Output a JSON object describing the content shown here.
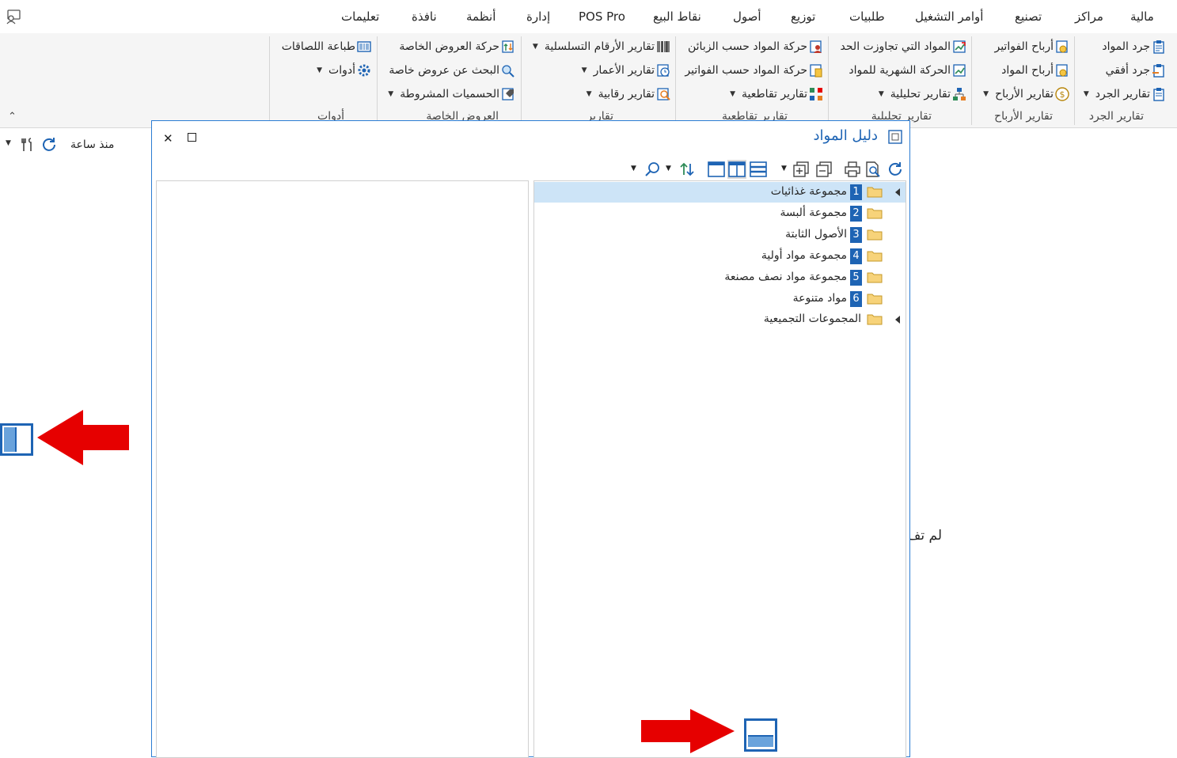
{
  "menu": {
    "items": [
      "مالية",
      "مراكز",
      "تصنيع",
      "أوامر التشغيل",
      "طلبيات",
      "توزيع",
      "أصول",
      "نقاط البيع",
      "POS Pro",
      "إدارة",
      "أنظمة",
      "نافذة",
      "تعليمات"
    ]
  },
  "ribbon": {
    "inventory_reports": {
      "label": "تقارير الجرد",
      "items": [
        "جرد المواد",
        "جرد أفقي",
        "تقارير الجرد"
      ]
    },
    "profit_reports": {
      "label": "تقارير الأرباح",
      "items": [
        "أرباح الفواتير",
        "أرباح المواد",
        "تقارير الأرباح"
      ]
    },
    "analytic_reports": {
      "label": "تقارير تحليلية",
      "items": [
        "المواد التي تجاوزت الحد",
        "الحركة الشهرية للمواد",
        "تقارير تحليلية"
      ]
    },
    "cross_reports": {
      "label": "تقارير تقاطعية",
      "items": [
        "حركة المواد حسب الزبائن",
        "حركة المواد حسب الفواتير",
        "تقارير تقاطعية"
      ]
    },
    "reports": {
      "label": "تقارير",
      "items": [
        "تقارير الأرقام التسلسلية",
        "تقارير الأعمار",
        "تقارير رقابية"
      ]
    },
    "special_offers": {
      "label": "العروض الخاصة",
      "items": [
        "حركة العروض الخاصة",
        "البحث عن عروض خاصة",
        "الحسميات المشروطة"
      ]
    },
    "tools": {
      "label": "أدوات",
      "items": [
        "طباعة اللصاقات",
        "أدوات"
      ]
    }
  },
  "left_pane": {
    "since_label": "منذ ساعة"
  },
  "background_text": "لم تف",
  "dialog": {
    "title": "دليل المواد",
    "tree": [
      {
        "num": "1",
        "label": "مجموعة غذائيات",
        "selected": true,
        "expandable": true
      },
      {
        "num": "2",
        "label": "مجموعة ألبسة",
        "selected": false,
        "expandable": false
      },
      {
        "num": "3",
        "label": "الأصول الثابتة",
        "selected": false,
        "expandable": false
      },
      {
        "num": "4",
        "label": "مجموعة مواد أولية",
        "selected": false,
        "expandable": false
      },
      {
        "num": "5",
        "label": "مجموعة مواد نصف مصنعة",
        "selected": false,
        "expandable": false
      },
      {
        "num": "6",
        "label": "مواد متنوعة",
        "selected": false,
        "expandable": false
      },
      {
        "num": "",
        "label": "المجموعات التجميعية",
        "selected": false,
        "expandable": true
      }
    ]
  },
  "colors": {
    "accent": "#1e64b4",
    "selection": "#cde4f7",
    "arrow": "#e60000",
    "folder": "#f0c060"
  }
}
